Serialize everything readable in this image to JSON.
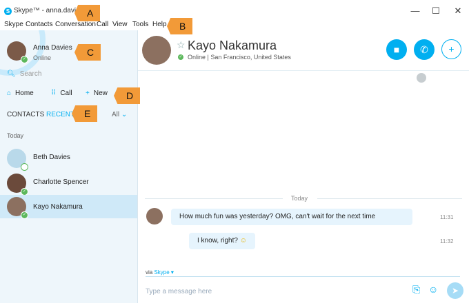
{
  "window": {
    "title": "Skype™ - anna.davies42"
  },
  "menu": [
    "Skype",
    "Contacts",
    "Conversation",
    "Call",
    "View",
    "Tools",
    "Help"
  ],
  "callouts": {
    "a": "A",
    "b": "B",
    "c": "C",
    "d": "D",
    "e": "E"
  },
  "me": {
    "name": "Anna Davies",
    "status": "Online"
  },
  "search": {
    "placeholder": "Search"
  },
  "nav": {
    "home": "Home",
    "call": "Call",
    "new": "New"
  },
  "tabs": {
    "contacts": "CONTACTS",
    "recent": "RECENT",
    "filter": "All"
  },
  "section": "Today",
  "contacts": [
    {
      "name": "Beth Davies"
    },
    {
      "name": "Charlotte Spencer"
    },
    {
      "name": "Kayo Nakamura"
    }
  ],
  "conversation": {
    "name": "Kayo Nakamura",
    "status": "Online  |  San Francisco, United States",
    "date_divider": "Today",
    "messages": [
      {
        "text": "How much fun was yesterday? OMG, can't wait for the next time",
        "time": "11:31"
      },
      {
        "text": "I know, right?",
        "time": "11:32"
      }
    ]
  },
  "composer": {
    "via_prefix": "via",
    "via_service": "Skype",
    "placeholder": "Type a message here"
  },
  "colors": {
    "accent": "#00aff0",
    "callout": "#f29a38",
    "online": "#5cb85c",
    "selected": "#cfe9f8"
  }
}
